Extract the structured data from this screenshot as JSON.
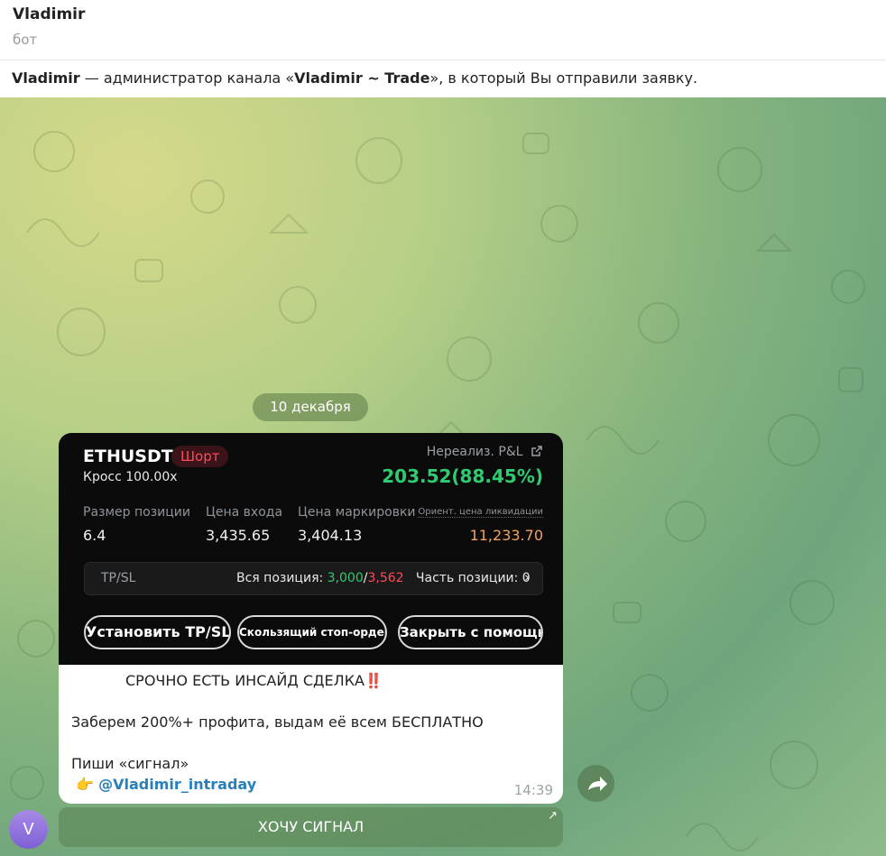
{
  "header": {
    "name": "Vladimir",
    "subtitle": "бот"
  },
  "notice": {
    "admin": "Vladimir",
    "text_mid": " — администратор канала «",
    "channel": "Vladimir ~ Trade",
    "text_end": "», в который Вы отправили заявку."
  },
  "chat": {
    "date": "10 декабря",
    "message": {
      "screenshot": {
        "symbol": "ETHUSDT",
        "side": "Шорт",
        "leverage": "Кросс 100.00x",
        "unrealized_label": "Нереализ. P&L",
        "pnl": "203.52(88.45%)",
        "size_label": "Размер позиции",
        "size_value": "6.4",
        "entry_label": "Цена входа",
        "entry_value": "3,435.65",
        "mark_label": "Цена маркировки",
        "mark_value": "3,404.13",
        "liq_label": "Ориент. цена ликвидации",
        "liq_value": "11,233.70",
        "tpsl_label": "TP/SL",
        "whole_label": "Вся позиция: ",
        "whole_tp": "3,000",
        "sep": "/",
        "whole_sl": "3,562",
        "part_label": "Часть позиции: 0",
        "btn_tpsl": "Установить TP/SL",
        "btn_trailing": "Скользящий стоп-ордер",
        "btn_close": "Закрыть с помощью"
      },
      "line1": "СРОЧНО ЕСТЬ ИНСАЙД СДЕЛКА",
      "line1_emoji": "‼️",
      "line2": "Заберем 200%+ профита, выдам её всем БЕСПЛАТНО",
      "line3": "Пиши «сигнал»",
      "pointer_emoji": "👉",
      "link": "@Vladimir_intraday",
      "time": "14:39"
    },
    "avatar_letter": "V",
    "inline_button": "ХОЧУ СИГНАЛ",
    "inline_button_arrow": "↗"
  },
  "colors": {
    "positive": "#2ecc71",
    "negative": "#ff4a5b",
    "liquidation": "#f0a35e",
    "link": "#2a7fb8"
  }
}
